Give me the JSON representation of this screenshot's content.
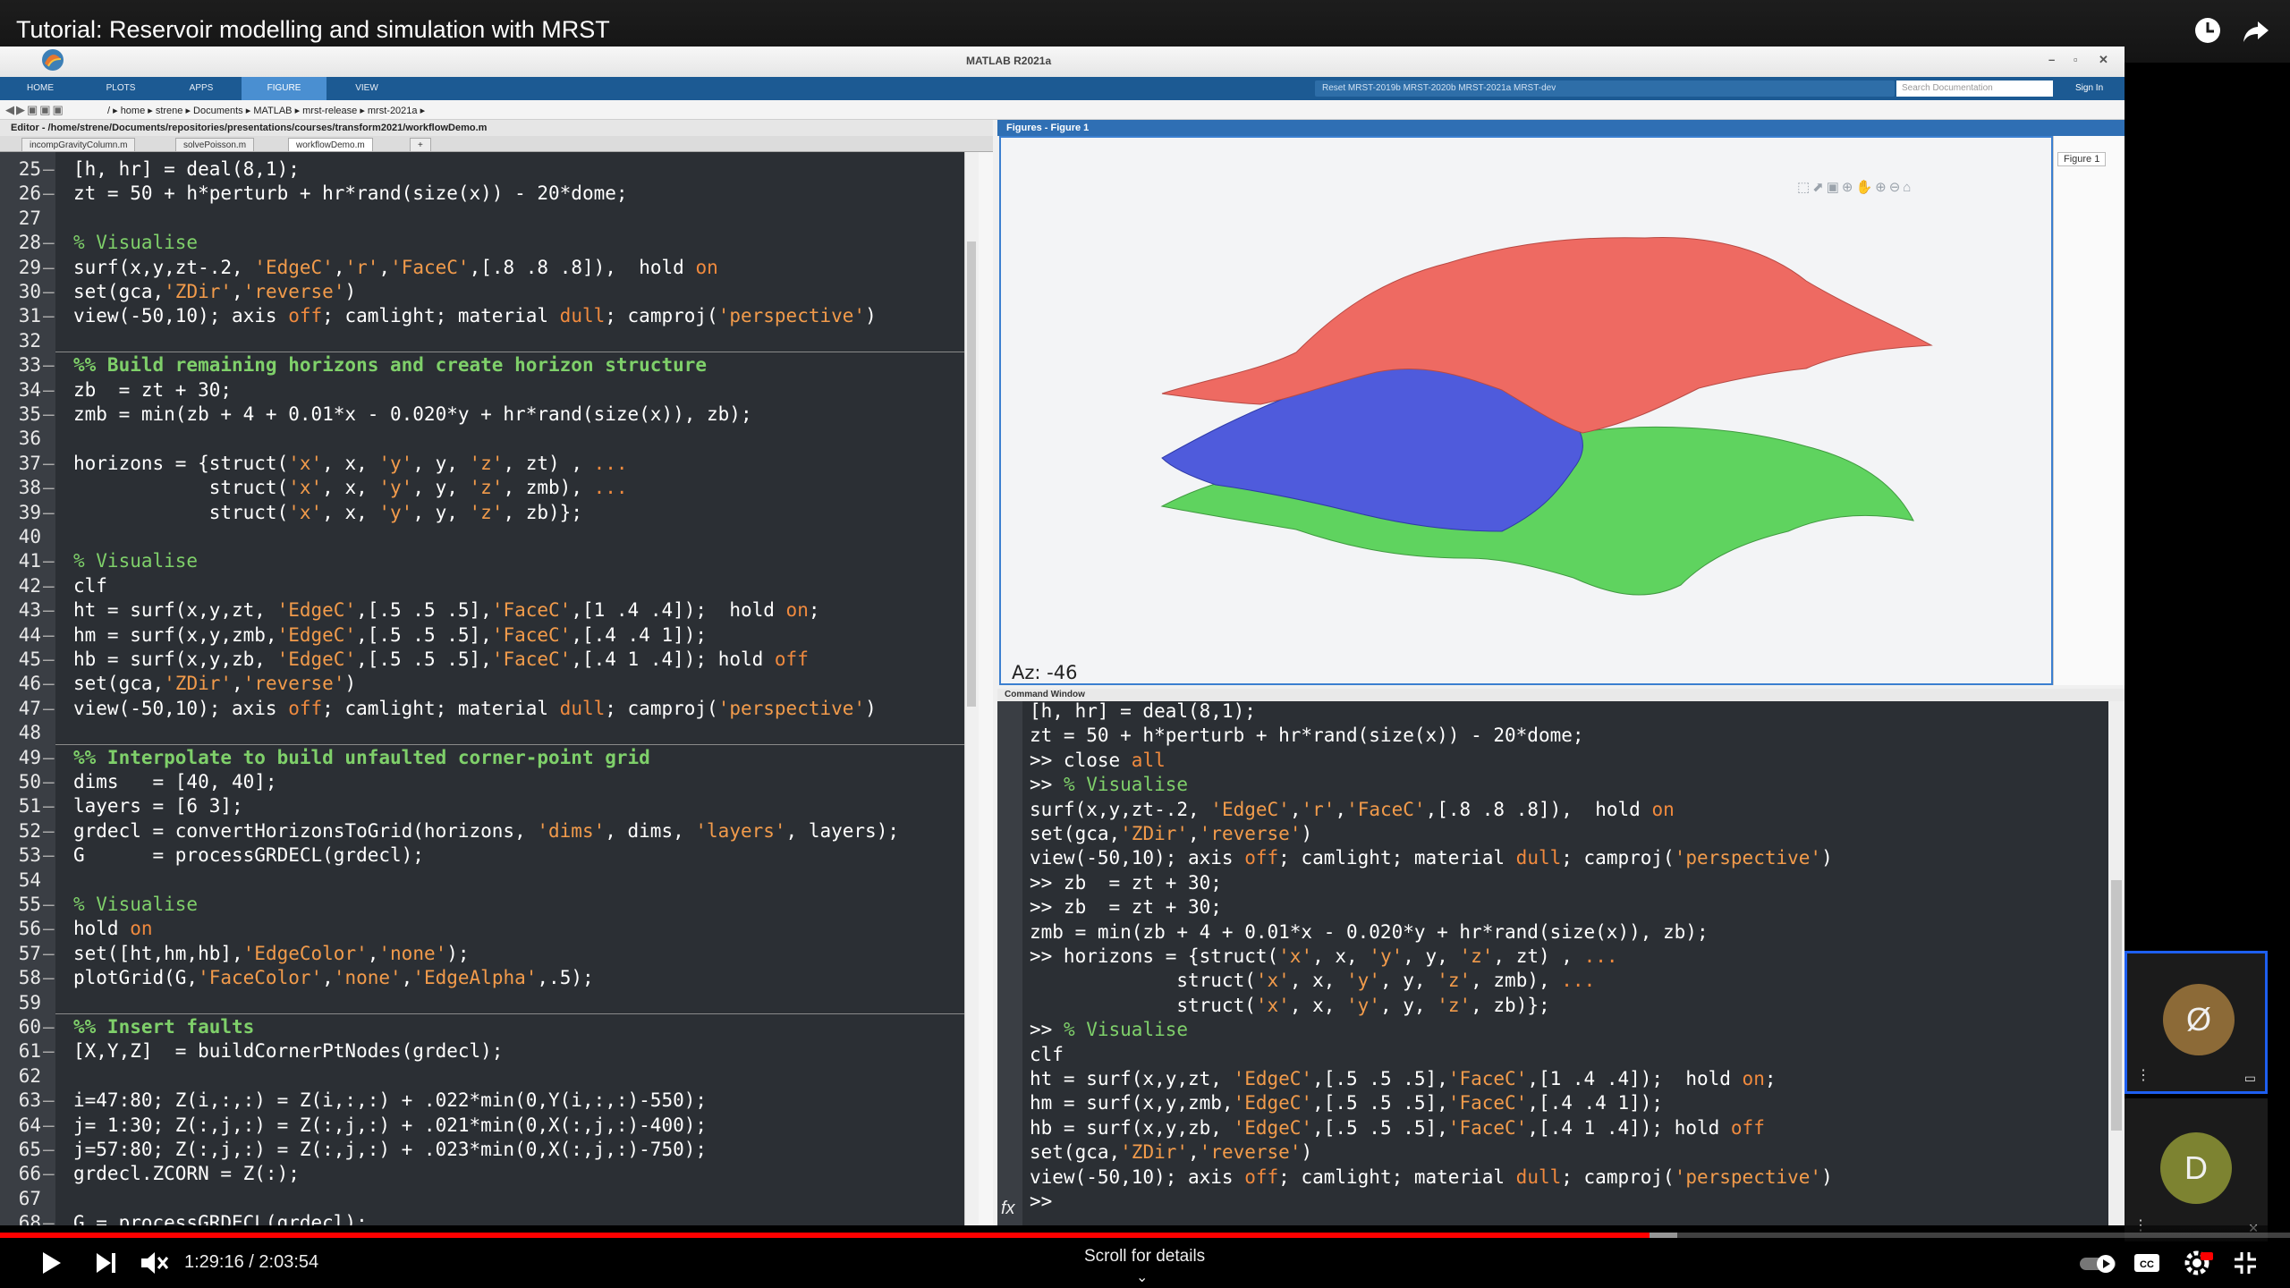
{
  "video": {
    "title": "Tutorial: Reservoir modelling and simulation with MRST",
    "time": "1:29:16 / 2:03:54",
    "progress": 0.7205,
    "scroll_hint": "Scroll for details",
    "colors": {
      "progress": "#ff0000",
      "background": "#000000"
    }
  },
  "matlab": {
    "window_title": "MATLAB R2021a",
    "tabs": [
      "HOME",
      "PLOTS",
      "APPS",
      "FIGURE",
      "VIEW"
    ],
    "active_tab": "FIGURE",
    "quick_access": "Reset   MRST-2019b   MRST-2020b   MRST-2021a   MRST-dev",
    "search_placeholder": "Search Documentation",
    "sign_in": "Sign In",
    "breadcrumb": "/ ▸ home ▸ strene ▸ Documents ▸ MATLAB ▸ mrst-release ▸ mrst-2021a ▸",
    "editor_path": "Editor - /home/strene/Documents/repositories/presentations/courses/transform2021/workflowDemo.m",
    "editor_tabs": [
      "incompGravityColumn.m",
      "solvePoisson.m",
      "workflowDemo.m",
      "+"
    ],
    "figure_title": "Figures - Figure 1",
    "figure_tab": "Figure 1",
    "az_label": "Az: -46",
    "command_window_title": "Command Window",
    "colors": {
      "tab_strip": "#1c5a93",
      "editor_bg": "#2b2f34",
      "string": "#f29b4b",
      "comment": "#7fd06a",
      "keyword": "#f08a3e"
    }
  },
  "editor_lines": [
    {
      "n": "25",
      "t": [
        [
          "[h, hr] = deal(8,1);",
          "p"
        ]
      ]
    },
    {
      "n": "26",
      "t": [
        [
          "zt = 50 + h*perturb + hr*rand(size(x)) - 20*dome;",
          "p"
        ]
      ]
    },
    {
      "n": "27",
      "t": []
    },
    {
      "n": "28",
      "t": [
        [
          "% Visualise",
          "c"
        ]
      ]
    },
    {
      "n": "29",
      "t": [
        [
          "surf(x,y,zt-.2, ",
          "p"
        ],
        [
          "'EdgeC'",
          "s"
        ],
        [
          ",",
          "p"
        ],
        [
          "'r'",
          "s"
        ],
        [
          ",",
          "p"
        ],
        [
          "'FaceC'",
          "s"
        ],
        [
          ",[.8 .8 .8]),  hold ",
          "p"
        ],
        [
          "on",
          "k"
        ]
      ]
    },
    {
      "n": "30",
      "t": [
        [
          "set(gca,",
          "p"
        ],
        [
          "'ZDir'",
          "s"
        ],
        [
          ",",
          "p"
        ],
        [
          "'reverse'",
          "s"
        ],
        [
          ")",
          "p"
        ]
      ]
    },
    {
      "n": "31",
      "t": [
        [
          "view(-50,10); axis ",
          "p"
        ],
        [
          "off",
          "k"
        ],
        [
          "; camlight; material ",
          "p"
        ],
        [
          "dull",
          "k"
        ],
        [
          "; camproj(",
          "p"
        ],
        [
          "'perspective'",
          "s"
        ],
        [
          ")",
          "p"
        ]
      ]
    },
    {
      "n": "32",
      "t": []
    },
    {
      "n": "33",
      "t": [
        [
          "%% Build remaining horizons and create horizon structure",
          "h"
        ]
      ],
      "cell": true
    },
    {
      "n": "34",
      "t": [
        [
          "zb  = zt + 30;",
          "p"
        ]
      ]
    },
    {
      "n": "35",
      "t": [
        [
          "zmb = min(zb + 4 + 0.01*x - 0.020*y + hr*rand(size(x)), zb);",
          "p"
        ]
      ]
    },
    {
      "n": "36",
      "t": []
    },
    {
      "n": "37",
      "t": [
        [
          "horizons = {struct(",
          "p"
        ],
        [
          "'x'",
          "s"
        ],
        [
          ", x, ",
          "p"
        ],
        [
          "'y'",
          "s"
        ],
        [
          ", y, ",
          "p"
        ],
        [
          "'z'",
          "s"
        ],
        [
          ", zt) , ",
          "p"
        ],
        [
          "...",
          "k"
        ]
      ]
    },
    {
      "n": "38",
      "t": [
        [
          "            struct(",
          "p"
        ],
        [
          "'x'",
          "s"
        ],
        [
          ", x, ",
          "p"
        ],
        [
          "'y'",
          "s"
        ],
        [
          ", y, ",
          "p"
        ],
        [
          "'z'",
          "s"
        ],
        [
          ", zmb), ",
          "p"
        ],
        [
          "...",
          "k"
        ]
      ]
    },
    {
      "n": "39",
      "t": [
        [
          "            struct(",
          "p"
        ],
        [
          "'x'",
          "s"
        ],
        [
          ", x, ",
          "p"
        ],
        [
          "'y'",
          "s"
        ],
        [
          ", y, ",
          "p"
        ],
        [
          "'z'",
          "s"
        ],
        [
          ", zb)};",
          "p"
        ]
      ]
    },
    {
      "n": "40",
      "t": []
    },
    {
      "n": "41",
      "t": [
        [
          "% Visualise",
          "c"
        ]
      ]
    },
    {
      "n": "42",
      "t": [
        [
          "clf",
          "p"
        ]
      ]
    },
    {
      "n": "43",
      "t": [
        [
          "ht = surf(x,y,zt, ",
          "p"
        ],
        [
          "'EdgeC'",
          "s"
        ],
        [
          ",[.5 .5 .5],",
          "p"
        ],
        [
          "'FaceC'",
          "s"
        ],
        [
          ",[1 .4 .4]);  hold ",
          "p"
        ],
        [
          "on",
          "k"
        ],
        [
          ";",
          "p"
        ]
      ]
    },
    {
      "n": "44",
      "t": [
        [
          "hm = surf(x,y,zmb,",
          "p"
        ],
        [
          "'EdgeC'",
          "s"
        ],
        [
          ",[.5 .5 .5],",
          "p"
        ],
        [
          "'FaceC'",
          "s"
        ],
        [
          ",[.4 .4 1]);",
          "p"
        ]
      ]
    },
    {
      "n": "45",
      "t": [
        [
          "hb = surf(x,y,zb, ",
          "p"
        ],
        [
          "'EdgeC'",
          "s"
        ],
        [
          ",[.5 .5 .5],",
          "p"
        ],
        [
          "'FaceC'",
          "s"
        ],
        [
          ",[.4 1 .4]); hold ",
          "p"
        ],
        [
          "off",
          "k"
        ]
      ]
    },
    {
      "n": "46",
      "t": [
        [
          "set(gca,",
          "p"
        ],
        [
          "'ZDir'",
          "s"
        ],
        [
          ",",
          "p"
        ],
        [
          "'reverse'",
          "s"
        ],
        [
          ")",
          "p"
        ]
      ]
    },
    {
      "n": "47",
      "t": [
        [
          "view(-50,10); axis ",
          "p"
        ],
        [
          "off",
          "k"
        ],
        [
          "; camlight; material ",
          "p"
        ],
        [
          "dull",
          "k"
        ],
        [
          "; camproj(",
          "p"
        ],
        [
          "'perspective'",
          "s"
        ],
        [
          ")",
          "p"
        ]
      ]
    },
    {
      "n": "48",
      "t": []
    },
    {
      "n": "49",
      "t": [
        [
          "%% Interpolate to build unfaulted corner-point grid",
          "h"
        ]
      ],
      "cell": true
    },
    {
      "n": "50",
      "t": [
        [
          "dims   = [40, 40];",
          "p"
        ]
      ]
    },
    {
      "n": "51",
      "t": [
        [
          "layers = [6 3];",
          "p"
        ]
      ]
    },
    {
      "n": "52",
      "t": [
        [
          "grdecl = convertHorizonsToGrid(horizons, ",
          "p"
        ],
        [
          "'dims'",
          "s"
        ],
        [
          ", dims, ",
          "p"
        ],
        [
          "'layers'",
          "s"
        ],
        [
          ", layers);",
          "p"
        ]
      ]
    },
    {
      "n": "53",
      "t": [
        [
          "G      = processGRDECL(grdecl);",
          "p"
        ]
      ]
    },
    {
      "n": "54",
      "t": []
    },
    {
      "n": "55",
      "t": [
        [
          "% Visualise",
          "c"
        ]
      ]
    },
    {
      "n": "56",
      "t": [
        [
          "hold ",
          "p"
        ],
        [
          "on",
          "k"
        ]
      ]
    },
    {
      "n": "57",
      "t": [
        [
          "set([ht,hm,hb],",
          "p"
        ],
        [
          "'EdgeColor'",
          "s"
        ],
        [
          ",",
          "p"
        ],
        [
          "'none'",
          "s"
        ],
        [
          ");",
          "p"
        ]
      ]
    },
    {
      "n": "58",
      "t": [
        [
          "plotGrid(G,",
          "p"
        ],
        [
          "'FaceColor'",
          "s"
        ],
        [
          ",",
          "p"
        ],
        [
          "'none'",
          "s"
        ],
        [
          ",",
          "p"
        ],
        [
          "'EdgeAlpha'",
          "s"
        ],
        [
          ",.5);",
          "p"
        ]
      ]
    },
    {
      "n": "59",
      "t": []
    },
    {
      "n": "60",
      "t": [
        [
          "%% Insert faults",
          "h"
        ]
      ],
      "cell": true
    },
    {
      "n": "61",
      "t": [
        [
          "[X,Y,Z]  = buildCornerPtNodes(grdecl);",
          "p"
        ]
      ]
    },
    {
      "n": "62",
      "t": []
    },
    {
      "n": "63",
      "t": [
        [
          "i=47:80; Z(i,:,:) = Z(i,:,:) + .022*min(0,Y(i,:,:)-550);",
          "p"
        ]
      ]
    },
    {
      "n": "64",
      "t": [
        [
          "j= 1:30; Z(:,j,:) = Z(:,j,:) + .021*min(0,X(:,j,:)-400);",
          "p"
        ]
      ]
    },
    {
      "n": "65",
      "t": [
        [
          "j=57:80; Z(:,j,:) = Z(:,j,:) + .023*min(0,X(:,j,:)-750);",
          "p"
        ]
      ]
    },
    {
      "n": "66",
      "t": [
        [
          "grdecl.ZCORN = Z(:);",
          "p"
        ]
      ]
    },
    {
      "n": "67",
      "t": []
    },
    {
      "n": "68",
      "t": [
        [
          "G = processGRDECL(grdecl);",
          "p"
        ]
      ]
    }
  ],
  "command_lines": [
    {
      "t": [
        [
          "[h, hr] = deal(8,1);",
          "p"
        ]
      ]
    },
    {
      "t": [
        [
          "zt = 50 + h*perturb + hr*rand(size(x)) - 20*dome;",
          "p"
        ]
      ]
    },
    {
      "t": [
        [
          ">> close ",
          "p"
        ],
        [
          "all",
          "k"
        ]
      ]
    },
    {
      "t": [
        [
          ">> ",
          "p"
        ],
        [
          "% Visualise",
          "c"
        ]
      ]
    },
    {
      "t": [
        [
          "surf(x,y,zt-.2, ",
          "p"
        ],
        [
          "'EdgeC'",
          "s"
        ],
        [
          ",",
          "p"
        ],
        [
          "'r'",
          "s"
        ],
        [
          ",",
          "p"
        ],
        [
          "'FaceC'",
          "s"
        ],
        [
          ",[.8 .8 .8]),  hold ",
          "p"
        ],
        [
          "on",
          "k"
        ]
      ]
    },
    {
      "t": [
        [
          "set(gca,",
          "p"
        ],
        [
          "'ZDir'",
          "s"
        ],
        [
          ",",
          "p"
        ],
        [
          "'reverse'",
          "s"
        ],
        [
          ")",
          "p"
        ]
      ]
    },
    {
      "t": [
        [
          "view(-50,10); axis ",
          "p"
        ],
        [
          "off",
          "k"
        ],
        [
          "; camlight; material ",
          "p"
        ],
        [
          "dull",
          "k"
        ],
        [
          "; camproj(",
          "p"
        ],
        [
          "'perspective'",
          "s"
        ],
        [
          ")",
          "p"
        ]
      ]
    },
    {
      "t": [
        [
          ">> zb  = zt + 30;",
          "p"
        ]
      ]
    },
    {
      "t": [
        [
          ">> zb  = zt + 30;",
          "p"
        ]
      ]
    },
    {
      "t": [
        [
          "zmb = min(zb + 4 + 0.01*x - 0.020*y + hr*rand(size(x)), zb);",
          "p"
        ]
      ]
    },
    {
      "t": [
        [
          ">> horizons = {struct(",
          "p"
        ],
        [
          "'x'",
          "s"
        ],
        [
          ", x, ",
          "p"
        ],
        [
          "'y'",
          "s"
        ],
        [
          ", y, ",
          "p"
        ],
        [
          "'z'",
          "s"
        ],
        [
          ", zt) , ",
          "p"
        ],
        [
          "...",
          "k"
        ]
      ]
    },
    {
      "t": [
        [
          "             struct(",
          "p"
        ],
        [
          "'x'",
          "s"
        ],
        [
          ", x, ",
          "p"
        ],
        [
          "'y'",
          "s"
        ],
        [
          ", y, ",
          "p"
        ],
        [
          "'z'",
          "s"
        ],
        [
          ", zmb), ",
          "p"
        ],
        [
          "...",
          "k"
        ]
      ]
    },
    {
      "t": [
        [
          "             struct(",
          "p"
        ],
        [
          "'x'",
          "s"
        ],
        [
          ", x, ",
          "p"
        ],
        [
          "'y'",
          "s"
        ],
        [
          ", y, ",
          "p"
        ],
        [
          "'z'",
          "s"
        ],
        [
          ", zb)};",
          "p"
        ]
      ]
    },
    {
      "t": [
        [
          ">> ",
          "p"
        ],
        [
          "% Visualise",
          "c"
        ]
      ]
    },
    {
      "t": [
        [
          "clf",
          "p"
        ]
      ]
    },
    {
      "t": [
        [
          "ht = surf(x,y,zt, ",
          "p"
        ],
        [
          "'EdgeC'",
          "s"
        ],
        [
          ",[.5 .5 .5],",
          "p"
        ],
        [
          "'FaceC'",
          "s"
        ],
        [
          ",[1 .4 .4]);  hold ",
          "p"
        ],
        [
          "on",
          "k"
        ],
        [
          ";",
          "p"
        ]
      ]
    },
    {
      "t": [
        [
          "hm = surf(x,y,zmb,",
          "p"
        ],
        [
          "'EdgeC'",
          "s"
        ],
        [
          ",[.5 .5 .5],",
          "p"
        ],
        [
          "'FaceC'",
          "s"
        ],
        [
          ",[.4 .4 1]);",
          "p"
        ]
      ]
    },
    {
      "t": [
        [
          "hb = surf(x,y,zb, ",
          "p"
        ],
        [
          "'EdgeC'",
          "s"
        ],
        [
          ",[.5 .5 .5],",
          "p"
        ],
        [
          "'FaceC'",
          "s"
        ],
        [
          ",[.4 1 .4]); hold ",
          "p"
        ],
        [
          "off",
          "k"
        ]
      ]
    },
    {
      "t": [
        [
          "set(gca,",
          "p"
        ],
        [
          "'ZDir'",
          "s"
        ],
        [
          ",",
          "p"
        ],
        [
          "'reverse'",
          "s"
        ],
        [
          ")",
          "p"
        ]
      ]
    },
    {
      "t": [
        [
          "view(-50,10); axis ",
          "p"
        ],
        [
          "off",
          "k"
        ],
        [
          "; camlight; material ",
          "p"
        ],
        [
          "dull",
          "k"
        ],
        [
          "; camproj(",
          "p"
        ],
        [
          "'perspective'",
          "s"
        ],
        [
          ")",
          "p"
        ]
      ]
    },
    {
      "t": [
        [
          ">>",
          "p"
        ]
      ]
    }
  ],
  "participants": [
    {
      "initial": "Ø",
      "color": "#8c6a37",
      "active": true
    },
    {
      "initial": "D",
      "color": "#7d8331",
      "active": false
    }
  ],
  "figure_surfaces": [
    {
      "name": "top horizon",
      "color": "#ee6a62"
    },
    {
      "name": "middle horizon",
      "color": "#4f5bdc"
    },
    {
      "name": "bottom horizon",
      "color": "#5fd35f"
    }
  ]
}
